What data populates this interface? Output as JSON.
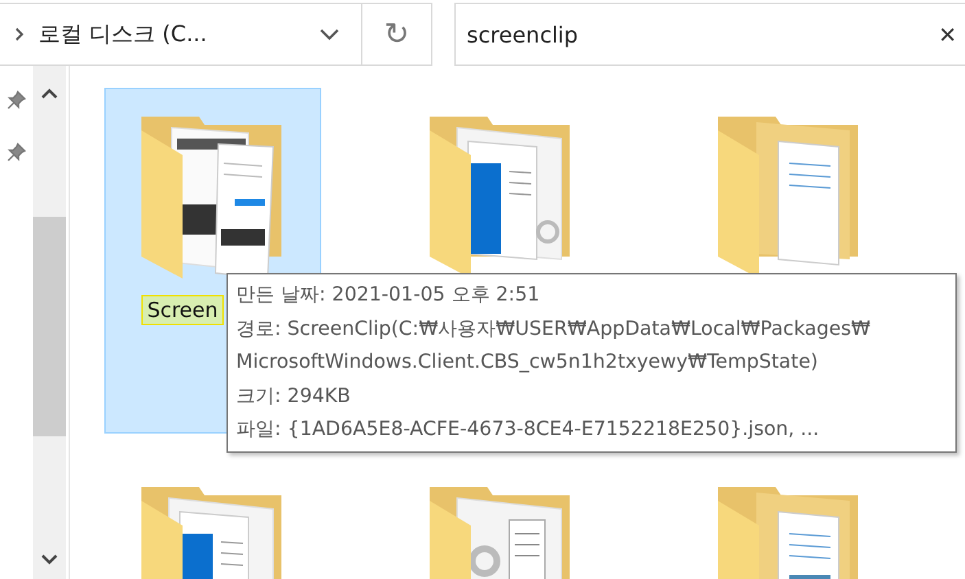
{
  "address": {
    "text": "로컬 디스크 (C..."
  },
  "refresh": {
    "glyph": "↻"
  },
  "search": {
    "value": "screenclip",
    "clear": "✕"
  },
  "folders": [
    {
      "kind": "screenshots",
      "label": "Screen",
      "selected": true
    },
    {
      "kind": "window",
      "selected": false
    },
    {
      "kind": "document",
      "selected": false
    },
    {
      "kind": "window",
      "selected": false
    },
    {
      "kind": "settings",
      "selected": false
    },
    {
      "kind": "photo",
      "selected": false
    }
  ],
  "tooltip": {
    "lines": [
      "만든 날짜: 2021-01-05 오후 2:51",
      "경로: ScreenClip(C:₩사용자₩USER₩AppData₩Local₩Packages₩",
      "MicrosoftWindows.Client.CBS_cw5n1h2txyewy₩TempState)",
      "크기: 294KB",
      "파일: {1AD6A5E8-ACFE-4673-8CE4-E7152218E250}.json, ..."
    ]
  }
}
